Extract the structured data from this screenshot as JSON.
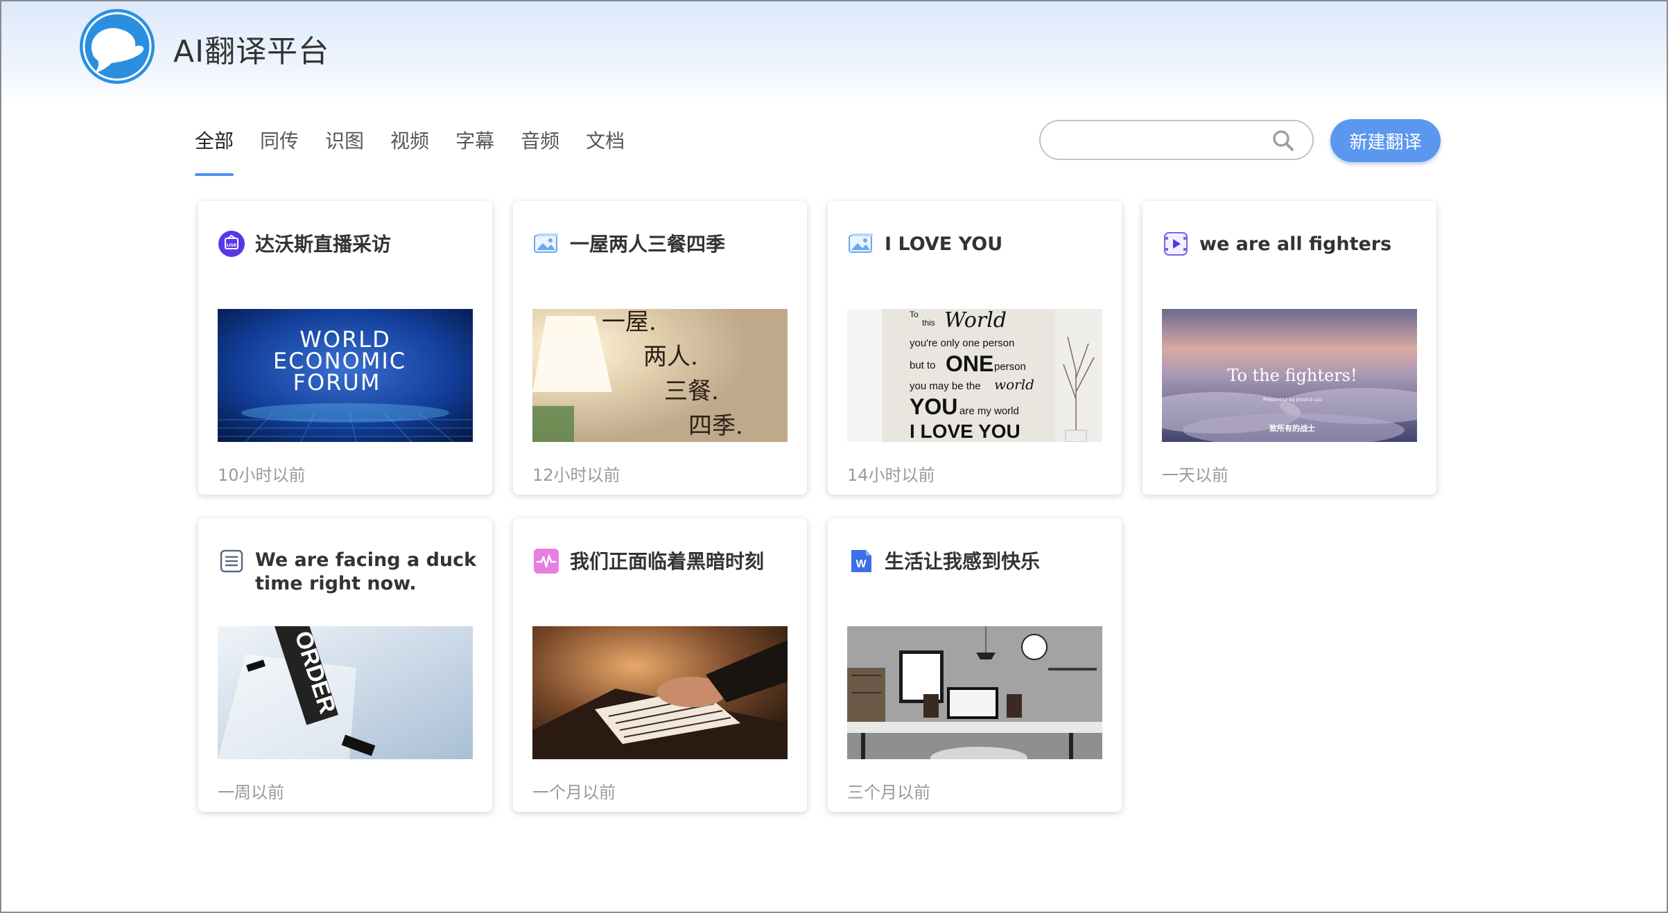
{
  "app": {
    "title": "AI翻译平台"
  },
  "tabs": [
    {
      "label": "全部",
      "active": true
    },
    {
      "label": "同传"
    },
    {
      "label": "识图"
    },
    {
      "label": "视频"
    },
    {
      "label": "字幕"
    },
    {
      "label": "音频"
    },
    {
      "label": "文档"
    }
  ],
  "search": {
    "value": "",
    "placeholder": ""
  },
  "new_button": {
    "label": "新建翻译"
  },
  "colors": {
    "accent": "#5b97ee",
    "tab_underline": "#4f8ff0"
  },
  "cards": [
    {
      "type": "live",
      "icon": "live-icon",
      "title": "达沃斯直播采访",
      "time": "10小时以前",
      "thumb_text": [
        "WORLD",
        "ECONOMIC",
        "FORUM"
      ]
    },
    {
      "type": "image",
      "icon": "image-icon",
      "title": "一屋两人三餐四季",
      "time": "12小时以前",
      "thumb_text": [
        "一屋.",
        "两人.",
        "三餐.",
        "四季."
      ]
    },
    {
      "type": "image",
      "icon": "image-icon",
      "title": "I LOVE YOU",
      "time": "14小时以前",
      "thumb_text": [
        "To",
        "this",
        "World",
        "you're only one person",
        "but to",
        "ONE",
        "person",
        "you may be the",
        "world",
        "YOU",
        "are my world",
        "I LOVE YOU"
      ]
    },
    {
      "type": "video",
      "icon": "video-icon",
      "title": "we are all fighters",
      "time": "一天以前",
      "thumb_text": [
        "To the fighters!",
        "Presented by Jessica Liu",
        "致所有的战士"
      ]
    },
    {
      "type": "subtitle",
      "icon": "subtitle-icon",
      "title": "We are facing a duck time right now.",
      "time": "一周以前",
      "thumb_text": [
        "ORDER"
      ]
    },
    {
      "type": "audio",
      "icon": "audio-icon",
      "title": "我们正面临着黑暗时刻",
      "time": "一个月以前"
    },
    {
      "type": "document",
      "icon": "word-doc-icon",
      "icon_letter": "W",
      "title": "生活让我感到快乐",
      "time": "三个月以前"
    }
  ]
}
